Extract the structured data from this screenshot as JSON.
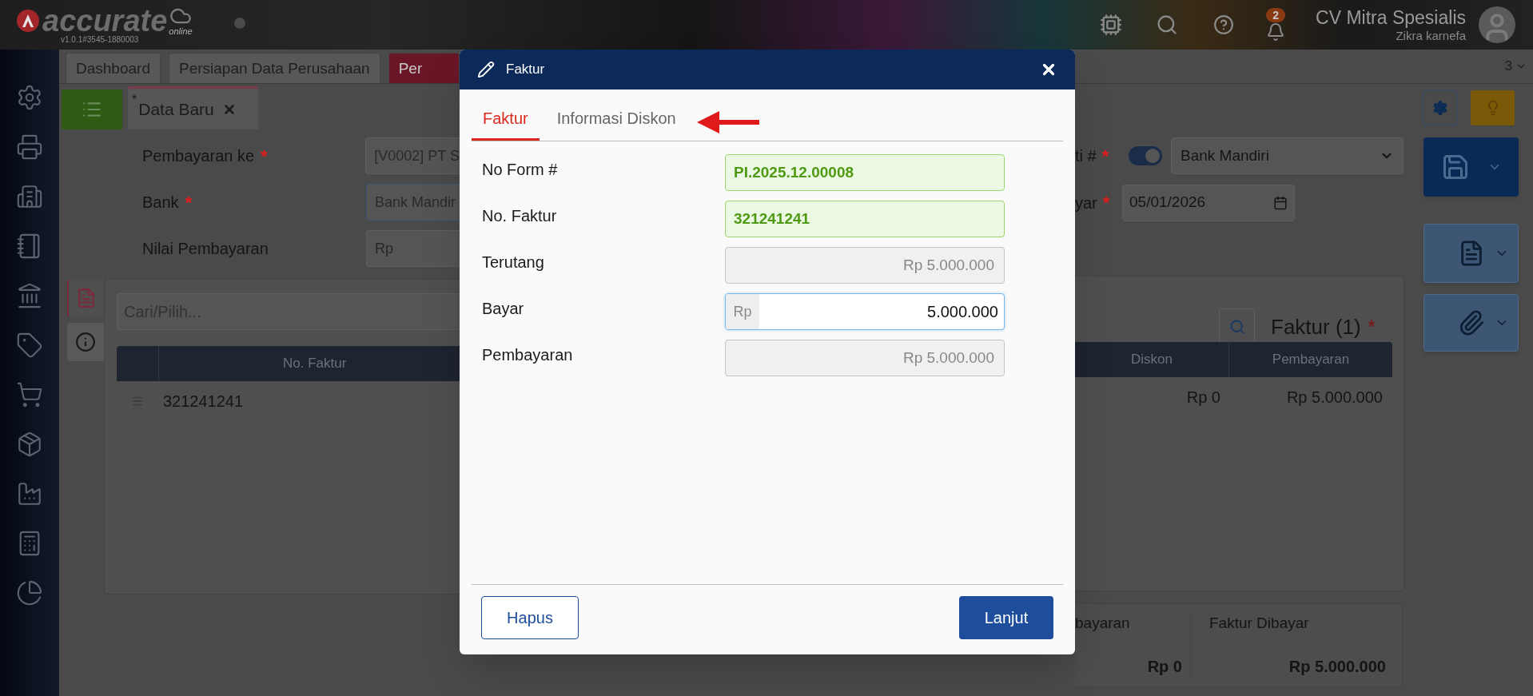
{
  "app": {
    "logo_text": "accurate",
    "logo_subtext": "online",
    "version": "v1.0.1#3545-1880003"
  },
  "top_bar": {
    "notification_count": "2",
    "company": "CV Mitra Spesialis",
    "user": "Zikra karnefa"
  },
  "tabs": [
    {
      "label": "Dashboard",
      "selected": false
    },
    {
      "label": "Persiapan Data Perusahaan",
      "selected": false
    },
    {
      "label": "Per",
      "selected": true
    }
  ],
  "tab_count": "3",
  "doc_tab": {
    "modified_mark": "*",
    "label": "Data Baru"
  },
  "form_left": [
    {
      "label": "Pembayaran ke",
      "required_mark": "*",
      "value": "[V0002] PT S",
      "focused": false
    },
    {
      "label": "Bank",
      "required_mark": "*",
      "value": "Bank Mandir",
      "focused": true
    },
    {
      "label": "Nilai Pembayaran",
      "prefix": "Rp",
      "focused": false
    }
  ],
  "form_right": {
    "cheque_label": "ti #",
    "cheque_mark": "*",
    "cheque_toggle_on": true,
    "bank_select": "Bank Mandiri",
    "date_label": "yar",
    "date_mark": "*",
    "date_value": "05/01/2026"
  },
  "panel_tabs": [
    {
      "kind": "document",
      "selected": true
    },
    {
      "kind": "info",
      "selected": false
    }
  ],
  "invoice_panel": {
    "search_placeholder": "Cari/Pilih...",
    "title": "Faktur (1)",
    "title_mark": "*",
    "columns": [
      "No. Faktur",
      "Diskon",
      "Pembayaran"
    ],
    "rows": [
      {
        "no_faktur": "321241241",
        "diskon": "Rp 0",
        "pembayaran": "Rp 5.000.000"
      }
    ]
  },
  "summary": [
    {
      "label": "bayaran",
      "value": "Rp 0"
    },
    {
      "label": "Faktur Dibayar",
      "value": "Rp 5.000.000"
    }
  ],
  "dialog": {
    "title": "Faktur",
    "tabs": [
      {
        "label": "Faktur",
        "selected": true
      },
      {
        "label": "Informasi Diskon",
        "selected": false
      }
    ],
    "fields": [
      {
        "label": "No Form #",
        "value": "PI.2025.12.00008",
        "kind": "highlighted"
      },
      {
        "label": "No. Faktur",
        "value": "321241241",
        "kind": "highlighted"
      },
      {
        "label": "Terutang",
        "value": "Rp 5.000.000",
        "kind": "readonly"
      },
      {
        "label": "Bayar",
        "prefix": "Rp",
        "value": "5.000.000",
        "kind": "input"
      },
      {
        "label": "Pembayaran",
        "value": "Rp 5.000.000",
        "kind": "readonly"
      }
    ],
    "buttons": [
      {
        "label": "Hapus",
        "kind": "secondary"
      },
      {
        "label": "Lanjut",
        "kind": "primary"
      }
    ]
  }
}
